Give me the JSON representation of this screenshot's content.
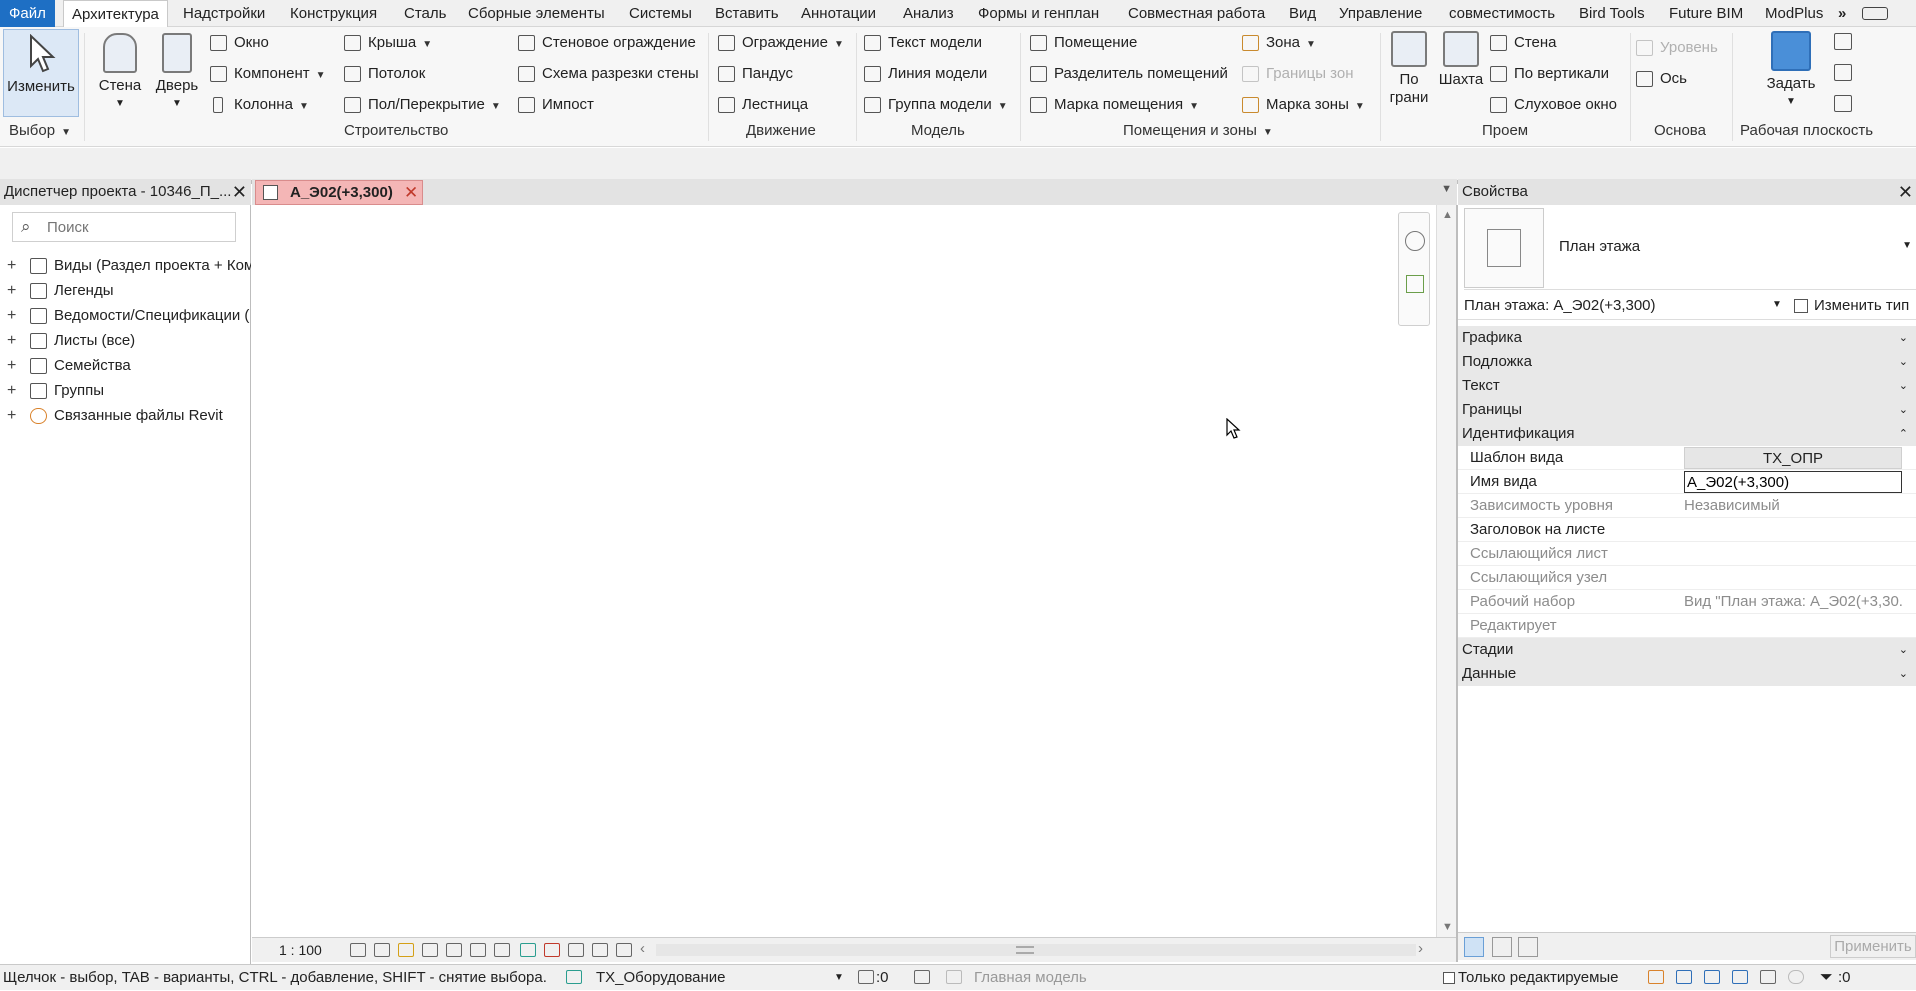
{
  "menubar": {
    "items": [
      "Файл",
      "Архитектура",
      "Надстройки",
      "Конструкция",
      "Сталь",
      "Сборные элементы",
      "Системы",
      "Вставить",
      "Аннотации",
      "Анализ",
      "Формы и генплан",
      "Совместная работа",
      "Вид",
      "Управление",
      "совместимость",
      "Bird Tools",
      "Future BIM",
      "ModPlus"
    ],
    "overflow": "»"
  },
  "ribbon": {
    "select": {
      "modify": "Изменить",
      "panel": "Выбор"
    },
    "build": {
      "wall": "Стена",
      "door": "Дверь",
      "window": "Окно",
      "component": "Компонент",
      "column": "Колонна",
      "roof": "Крыша",
      "ceiling": "Потолок",
      "floor": "Пол/Перекрытие",
      "curtain_system": "Стеновое ограждение",
      "curtain_grid": "Схема разрезки стены",
      "mullion": "Импост",
      "panel": "Строительство"
    },
    "circulation": {
      "railing": "Ограждение",
      "ramp": "Пандус",
      "stair": "Лестница",
      "panel": "Движение"
    },
    "model": {
      "text": "Текст модели",
      "line": "Линия  модели",
      "group": "Группа модели",
      "panel": "Модель"
    },
    "room": {
      "room": "Помещение",
      "separator": "Разделитель помещений",
      "tag": "Марка помещения",
      "area": "Зона",
      "boundary": "Границы  зон",
      "area_tag": "Марка  зоны",
      "panel": "Помещения и зоны"
    },
    "opening": {
      "by_face": "По\nграни",
      "shaft": "Шахта",
      "wall": "Стена",
      "vertical": "По вертикали",
      "dormer": "Слуховое окно",
      "panel": "Проем"
    },
    "datum": {
      "level": "Уровень",
      "grid": "Ось",
      "panel": "Основа"
    },
    "workplane": {
      "set": "Задать",
      "panel": "Рабочая плоскость"
    }
  },
  "project_browser": {
    "title": "Диспетчер проекта - 10346_П_...",
    "search_placeholder": "Поиск",
    "items": [
      "Виды (Раздел проекта + Ком",
      "Легенды",
      "Ведомости/Спецификации (",
      "Листы (все)",
      "Семейства",
      "Группы",
      "Связанные файлы Revit"
    ]
  },
  "view_tab": {
    "title": "А_Э02(+3,300)"
  },
  "view_bar": {
    "scale": "1 : 100"
  },
  "properties": {
    "title": "Свойства",
    "type_name": "План этажа",
    "selector": "План этажа: А_Э02(+3,300)",
    "edit_type": "Изменить тип",
    "groups_before": [
      "Графика",
      "Подложка",
      "Текст",
      "Границы"
    ],
    "identification": "Идентификация",
    "rows": [
      {
        "name": "Шаблон вида",
        "value": "ТХ_ОПР"
      },
      {
        "name": "Имя вида",
        "value": "А_Э02(+3,300)"
      },
      {
        "name": "Зависимость уровня",
        "value": "Независимый"
      },
      {
        "name": "Заголовок на листе",
        "value": ""
      },
      {
        "name": "Ссылающийся лист",
        "value": ""
      },
      {
        "name": "Ссылающийся узел",
        "value": ""
      },
      {
        "name": "Рабочий набор",
        "value": "Вид \"План этажа: А_Э02(+3,30..."
      },
      {
        "name": "Редактирует",
        "value": ""
      }
    ],
    "groups_after": [
      "Стадии",
      "Данные"
    ],
    "apply": "Применить"
  },
  "status": {
    "hint": "Щелчок - выбор, TAB - варианты, CTRL - добавление, SHIFT - снятие выбора.",
    "workset": "ТХ_Оборудование",
    "coord": ":0",
    "model": "Главная модель",
    "editable_only": "Только редактируемые",
    "filter": ":0"
  }
}
